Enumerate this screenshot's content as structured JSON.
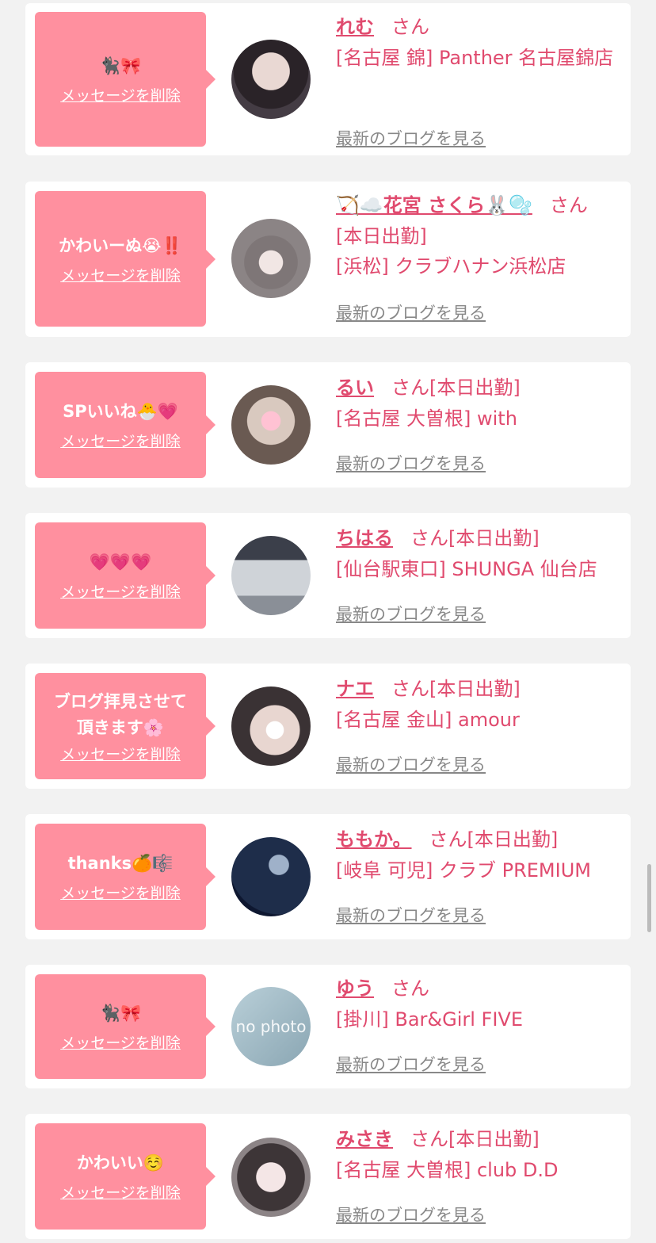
{
  "delete_label": "メッセージを削除",
  "blog_label": "最新のブログを見る",
  "san_label": "さん",
  "items": [
    {
      "message": "🐈‍⬛🎀",
      "name": "れむ",
      "status": "",
      "shop": "[名古屋 錦] Panther 名古屋錦店"
    },
    {
      "message": "かわいーぬ😭‼️",
      "name": "🏹☁️花宮 さくら🐰🫧",
      "status": "",
      "status_line": "[本日出勤]",
      "shop": "[浜松] クラブハナン浜松店"
    },
    {
      "message": "SPいいね🐣💗",
      "name": "るい",
      "status": "[本日出勤]",
      "shop": "[名古屋 大曽根] with"
    },
    {
      "message": "💗💗💗",
      "name": "ちはる",
      "status": "[本日出勤]",
      "shop": "[仙台駅東口] SHUNGA 仙台店"
    },
    {
      "message": "ブログ拝見させて\n頂きます🌸",
      "name": "ナエ",
      "status": "[本日出勤]",
      "shop": "[名古屋 金山] amour"
    },
    {
      "message": "thanks🍊🎼",
      "name": "ももか。",
      "status": "[本日出勤]",
      "shop": "[岐阜 可児] クラブ PREMIUM"
    },
    {
      "message": "🐈‍⬛🎀",
      "name": "ゆう",
      "status": "",
      "shop": "[掛川] Bar&Girl FIVE"
    },
    {
      "message": "かわいい☺️",
      "name": "みさき",
      "status": "[本日出勤]",
      "shop": "[名古屋 大曽根] club D.D"
    }
  ],
  "no_photo_text": "no photo",
  "colors": {
    "accent": "#e04a6e",
    "bubble": "#ff909f",
    "background": "#f2f2f2"
  }
}
